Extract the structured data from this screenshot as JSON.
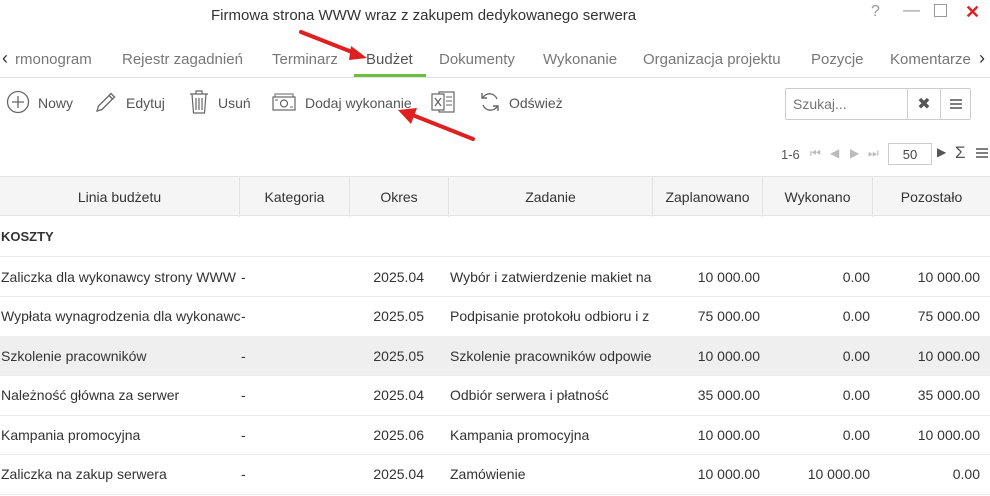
{
  "window": {
    "title": "Firmowa strona WWW wraz z zakupem dedykowanego serwera",
    "help": "?",
    "minimize": "—",
    "close": "✕"
  },
  "tabs": {
    "prev": "‹",
    "next": "›",
    "items": [
      "rmonogram",
      "Rejestr zagadnień",
      "Terminarz",
      "Budżet",
      "Dokumenty",
      "Wykonanie",
      "Organizacja projektu",
      "Pozycje",
      "Komentarze"
    ],
    "active": "Budżet"
  },
  "toolbar": {
    "new_label": "Nowy",
    "edit_label": "Edytuj",
    "delete_label": "Usuń",
    "add_exec_label": "Dodaj wykonanie",
    "refresh_label": "Odśwież",
    "search_placeholder": "Szukaj..."
  },
  "pager": {
    "range": "1-6",
    "page_size": "50",
    "sum": "Σ"
  },
  "grid": {
    "columns": [
      "Linia budżetu",
      "Kategoria",
      "Okres",
      "Zadanie",
      "Zaplanowano",
      "Wykonano",
      "Pozostało"
    ],
    "section": "KOSZTY",
    "rows": [
      [
        "Zaliczka dla wykonawcy strony WWW",
        "-",
        "2025.04",
        "Wybór i zatwierdzenie makiet na",
        "10 000.00",
        "0.00",
        "10 000.00"
      ],
      [
        "Wypłata wynagrodzenia dla wykonawcy",
        "-",
        "2025.05",
        "Podpisanie protokołu odbioru i z",
        "75 000.00",
        "0.00",
        "75 000.00"
      ],
      [
        "Szkolenie pracowników",
        "-",
        "2025.05",
        "Szkolenie pracowników odpowie",
        "10 000.00",
        "0.00",
        "10 000.00"
      ],
      [
        "Należność główna za serwer",
        "-",
        "2025.04",
        "Odbiór serwera i płatność",
        "35 000.00",
        "0.00",
        "35 000.00"
      ],
      [
        "Kampania promocyjna",
        "-",
        "2025.06",
        "Kampania promocyjna",
        "10 000.00",
        "0.00",
        "10 000.00"
      ],
      [
        "Zaliczka na zakup serwera",
        "-",
        "2025.04",
        "Zamówienie",
        "10 000.00",
        "10 000.00",
        "0.00"
      ]
    ],
    "highlighted_row": 2
  },
  "colors": {
    "accent": "#6cbf3a",
    "close": "#dd2222",
    "annotation_arrow": "#e02020"
  }
}
